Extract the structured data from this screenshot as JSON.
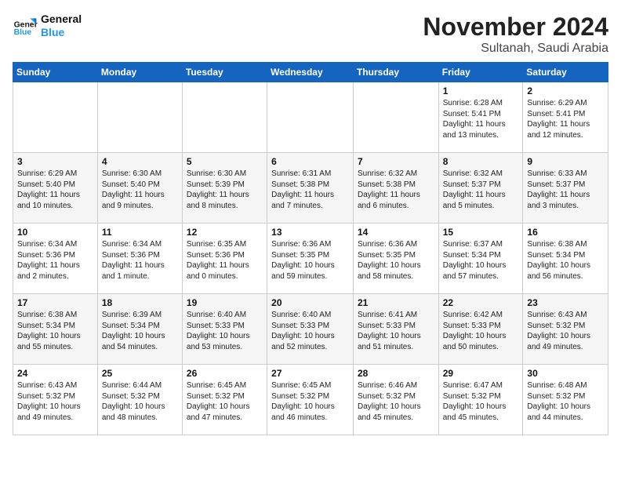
{
  "logo": {
    "line1": "General",
    "line2": "Blue"
  },
  "title": "November 2024",
  "subtitle": "Sultanah, Saudi Arabia",
  "days_header": [
    "Sunday",
    "Monday",
    "Tuesday",
    "Wednesday",
    "Thursday",
    "Friday",
    "Saturday"
  ],
  "weeks": [
    [
      {
        "day": "",
        "info": ""
      },
      {
        "day": "",
        "info": ""
      },
      {
        "day": "",
        "info": ""
      },
      {
        "day": "",
        "info": ""
      },
      {
        "day": "",
        "info": ""
      },
      {
        "day": "1",
        "info": "Sunrise: 6:28 AM\nSunset: 5:41 PM\nDaylight: 11 hours\nand 13 minutes."
      },
      {
        "day": "2",
        "info": "Sunrise: 6:29 AM\nSunset: 5:41 PM\nDaylight: 11 hours\nand 12 minutes."
      }
    ],
    [
      {
        "day": "3",
        "info": "Sunrise: 6:29 AM\nSunset: 5:40 PM\nDaylight: 11 hours\nand 10 minutes."
      },
      {
        "day": "4",
        "info": "Sunrise: 6:30 AM\nSunset: 5:40 PM\nDaylight: 11 hours\nand 9 minutes."
      },
      {
        "day": "5",
        "info": "Sunrise: 6:30 AM\nSunset: 5:39 PM\nDaylight: 11 hours\nand 8 minutes."
      },
      {
        "day": "6",
        "info": "Sunrise: 6:31 AM\nSunset: 5:38 PM\nDaylight: 11 hours\nand 7 minutes."
      },
      {
        "day": "7",
        "info": "Sunrise: 6:32 AM\nSunset: 5:38 PM\nDaylight: 11 hours\nand 6 minutes."
      },
      {
        "day": "8",
        "info": "Sunrise: 6:32 AM\nSunset: 5:37 PM\nDaylight: 11 hours\nand 5 minutes."
      },
      {
        "day": "9",
        "info": "Sunrise: 6:33 AM\nSunset: 5:37 PM\nDaylight: 11 hours\nand 3 minutes."
      }
    ],
    [
      {
        "day": "10",
        "info": "Sunrise: 6:34 AM\nSunset: 5:36 PM\nDaylight: 11 hours\nand 2 minutes."
      },
      {
        "day": "11",
        "info": "Sunrise: 6:34 AM\nSunset: 5:36 PM\nDaylight: 11 hours\nand 1 minute."
      },
      {
        "day": "12",
        "info": "Sunrise: 6:35 AM\nSunset: 5:36 PM\nDaylight: 11 hours\nand 0 minutes."
      },
      {
        "day": "13",
        "info": "Sunrise: 6:36 AM\nSunset: 5:35 PM\nDaylight: 10 hours\nand 59 minutes."
      },
      {
        "day": "14",
        "info": "Sunrise: 6:36 AM\nSunset: 5:35 PM\nDaylight: 10 hours\nand 58 minutes."
      },
      {
        "day": "15",
        "info": "Sunrise: 6:37 AM\nSunset: 5:34 PM\nDaylight: 10 hours\nand 57 minutes."
      },
      {
        "day": "16",
        "info": "Sunrise: 6:38 AM\nSunset: 5:34 PM\nDaylight: 10 hours\nand 56 minutes."
      }
    ],
    [
      {
        "day": "17",
        "info": "Sunrise: 6:38 AM\nSunset: 5:34 PM\nDaylight: 10 hours\nand 55 minutes."
      },
      {
        "day": "18",
        "info": "Sunrise: 6:39 AM\nSunset: 5:34 PM\nDaylight: 10 hours\nand 54 minutes."
      },
      {
        "day": "19",
        "info": "Sunrise: 6:40 AM\nSunset: 5:33 PM\nDaylight: 10 hours\nand 53 minutes."
      },
      {
        "day": "20",
        "info": "Sunrise: 6:40 AM\nSunset: 5:33 PM\nDaylight: 10 hours\nand 52 minutes."
      },
      {
        "day": "21",
        "info": "Sunrise: 6:41 AM\nSunset: 5:33 PM\nDaylight: 10 hours\nand 51 minutes."
      },
      {
        "day": "22",
        "info": "Sunrise: 6:42 AM\nSunset: 5:33 PM\nDaylight: 10 hours\nand 50 minutes."
      },
      {
        "day": "23",
        "info": "Sunrise: 6:43 AM\nSunset: 5:32 PM\nDaylight: 10 hours\nand 49 minutes."
      }
    ],
    [
      {
        "day": "24",
        "info": "Sunrise: 6:43 AM\nSunset: 5:32 PM\nDaylight: 10 hours\nand 49 minutes."
      },
      {
        "day": "25",
        "info": "Sunrise: 6:44 AM\nSunset: 5:32 PM\nDaylight: 10 hours\nand 48 minutes."
      },
      {
        "day": "26",
        "info": "Sunrise: 6:45 AM\nSunset: 5:32 PM\nDaylight: 10 hours\nand 47 minutes."
      },
      {
        "day": "27",
        "info": "Sunrise: 6:45 AM\nSunset: 5:32 PM\nDaylight: 10 hours\nand 46 minutes."
      },
      {
        "day": "28",
        "info": "Sunrise: 6:46 AM\nSunset: 5:32 PM\nDaylight: 10 hours\nand 45 minutes."
      },
      {
        "day": "29",
        "info": "Sunrise: 6:47 AM\nSunset: 5:32 PM\nDaylight: 10 hours\nand 45 minutes."
      },
      {
        "day": "30",
        "info": "Sunrise: 6:48 AM\nSunset: 5:32 PM\nDaylight: 10 hours\nand 44 minutes."
      }
    ]
  ]
}
